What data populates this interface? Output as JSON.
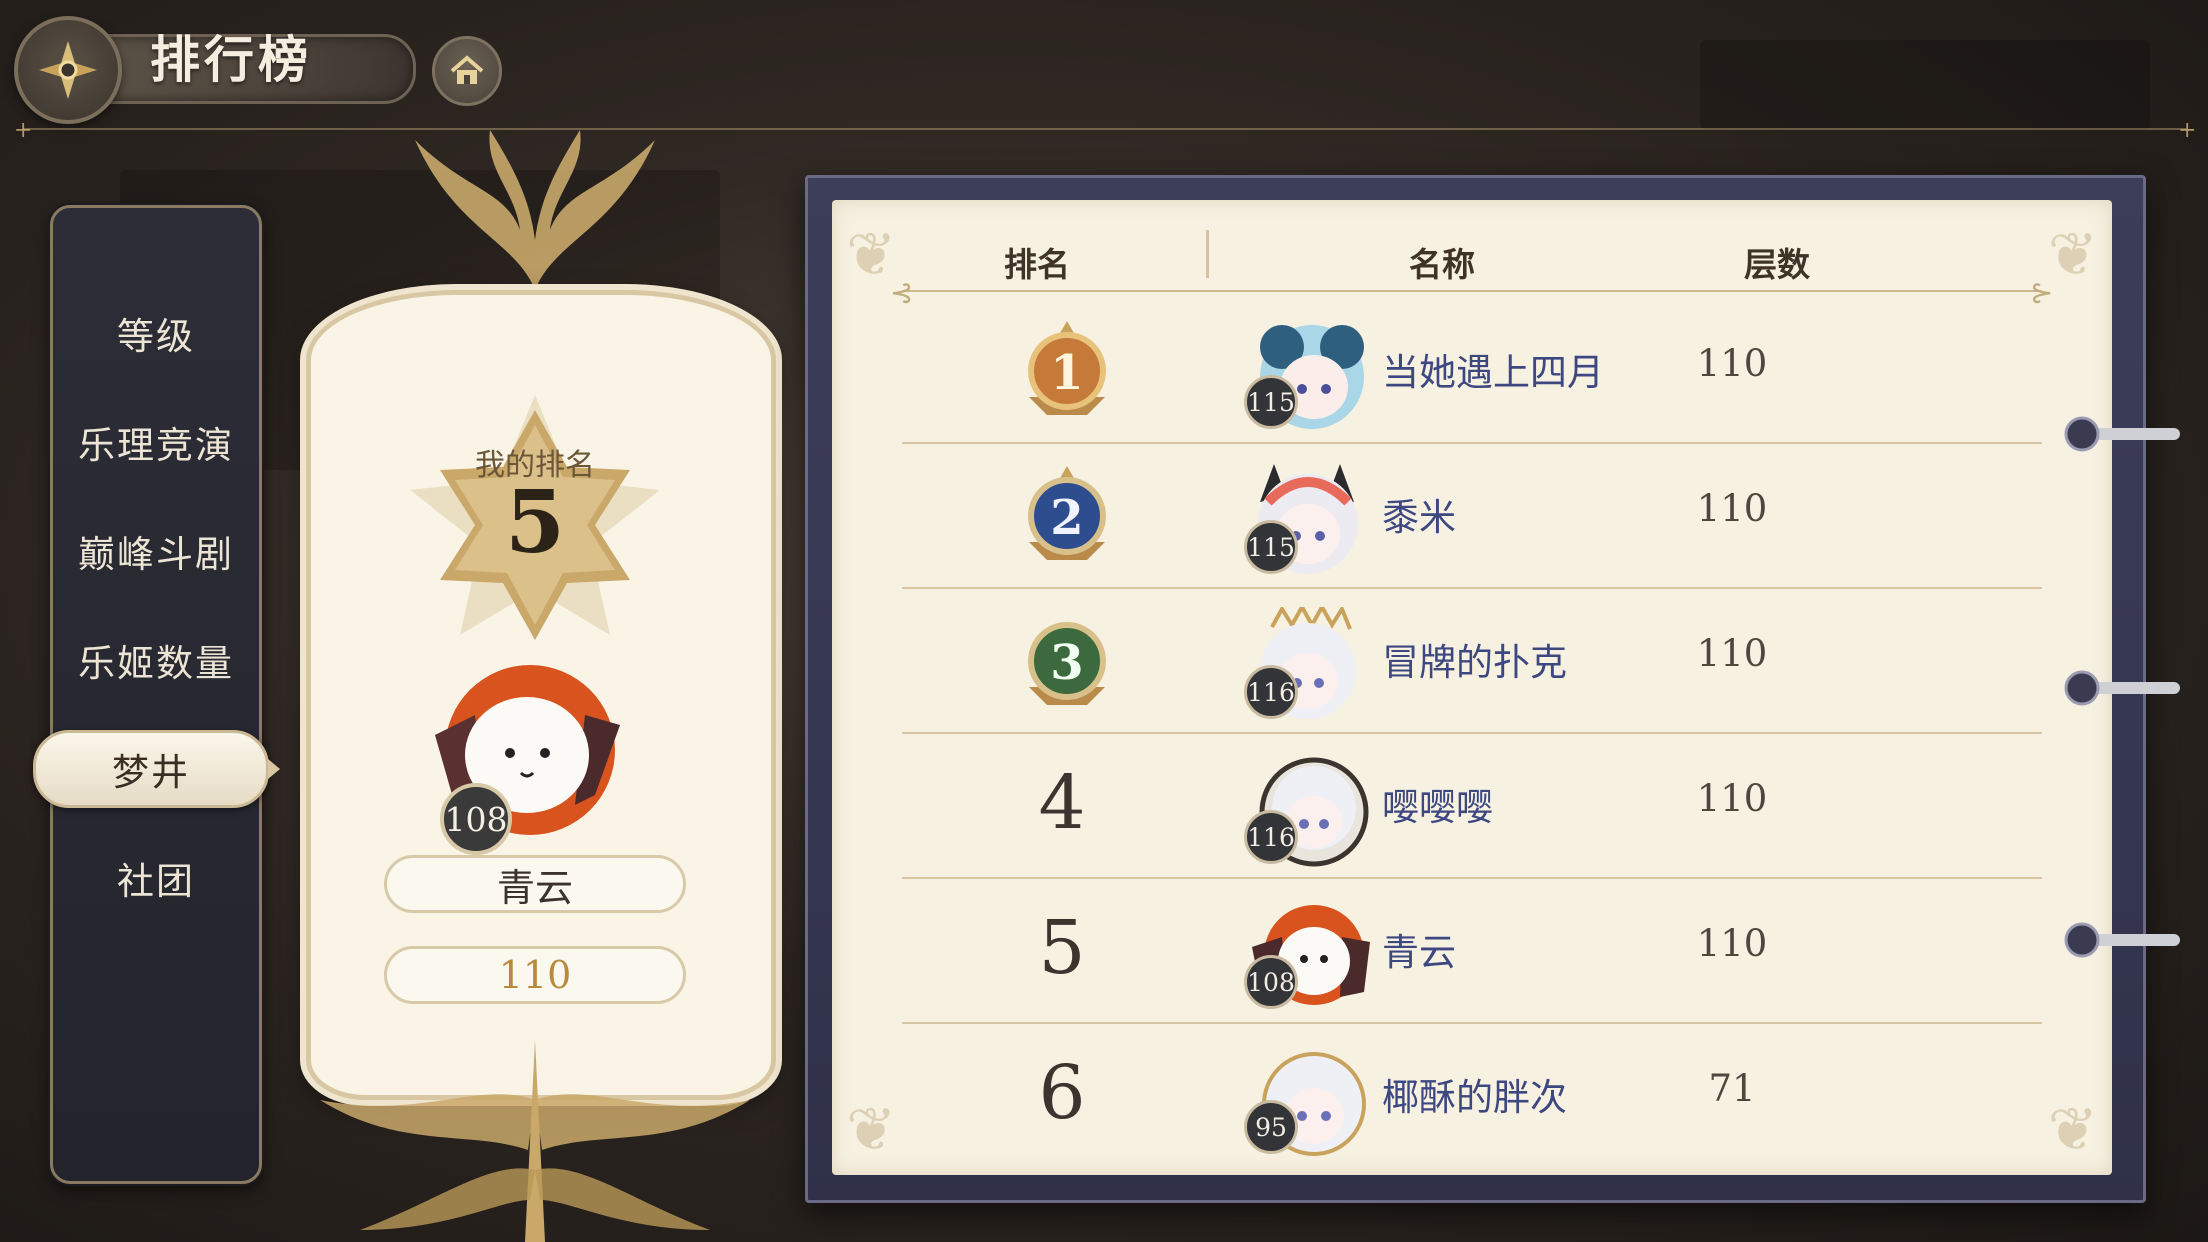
{
  "header": {
    "title": "排行榜",
    "back_icon": "ornament-back-icon",
    "home_icon": "home-icon"
  },
  "tabs": [
    {
      "label": "等级",
      "active": false
    },
    {
      "label": "乐理竞演",
      "active": false
    },
    {
      "label": "巅峰斗剧",
      "active": false
    },
    {
      "label": "乐姬数量",
      "active": false
    },
    {
      "label": "梦井",
      "active": true
    },
    {
      "label": "社团",
      "active": false
    }
  ],
  "my_rank": {
    "label": "我的排名",
    "rank": "5",
    "level": "108",
    "name": "青云",
    "floors": "110"
  },
  "table": {
    "headers": {
      "rank": "排名",
      "name": "名称",
      "floors": "层数"
    },
    "rows": [
      {
        "rank": "1",
        "medal": "gold",
        "level": "115",
        "name": "当她遇上四月",
        "floors": "110",
        "avatar": "blue-hair-girl"
      },
      {
        "rank": "2",
        "medal": "blue",
        "level": "115",
        "name": "黍米",
        "floors": "110",
        "avatar": "horned-girl"
      },
      {
        "rank": "3",
        "medal": "green",
        "level": "116",
        "name": "冒牌的扑克",
        "floors": "110",
        "avatar": "crowned-girl"
      },
      {
        "rank": "4",
        "medal": "",
        "level": "116",
        "name": "嘤嘤嘤",
        "floors": "110",
        "avatar": "white-hair-girl"
      },
      {
        "rank": "5",
        "medal": "",
        "level": "108",
        "name": "青云",
        "floors": "110",
        "avatar": "ghost-mascot"
      },
      {
        "rank": "6",
        "medal": "",
        "level": "95",
        "name": "椰酥的胖次",
        "floors": "71",
        "avatar": "ribbon-girl"
      }
    ]
  },
  "colors": {
    "gold": "#c9a35c",
    "name_text": "#3d4780",
    "panel_dark": "#2c2d36",
    "paper": "#f7f1e2"
  }
}
